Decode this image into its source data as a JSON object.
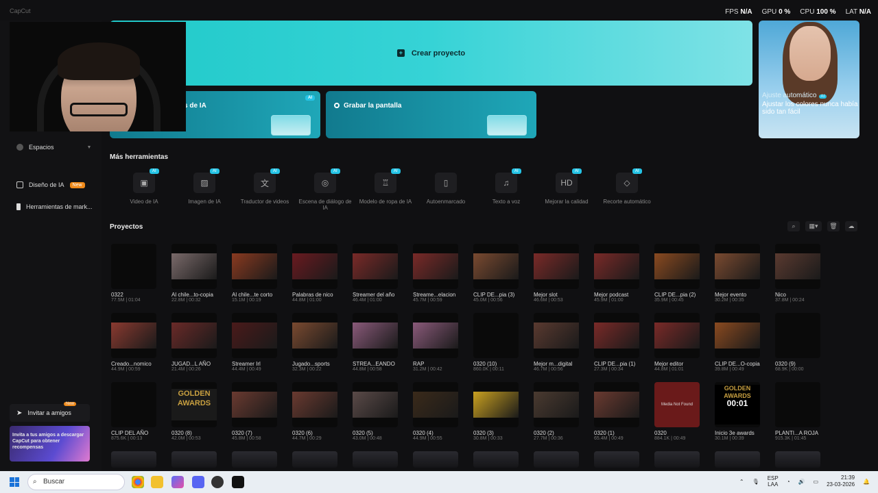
{
  "app": {
    "title": "CapCut"
  },
  "perf": [
    {
      "label": "FPS",
      "value": "N/A"
    },
    {
      "label": "GPU",
      "value": "0 %"
    },
    {
      "label": "CPU",
      "value": "100 %"
    },
    {
      "label": "LAT",
      "value": "N/A"
    }
  ],
  "sidebar": {
    "spaces": "Espacios",
    "ai_design": "Diseño de IA",
    "new_badge": "New",
    "marketing": "Herramientas de mark...",
    "invite": "Invitar a amigos",
    "invite_badge": "New",
    "promo": "Invita a tus amigos a descargar CapCut para obtener recompensas"
  },
  "hero": {
    "create": "Crear proyecto",
    "card1": "s de IA",
    "card2": "Grabar la pantalla",
    "ai": "AI"
  },
  "promo_right": {
    "t1": "Ajuste automático",
    "t2": "Ajustar los colores nunca había sido tan fácil"
  },
  "tools_title": "Más herramientas",
  "tools": [
    {
      "label": "Video de IA",
      "icon": "▣",
      "ai": true
    },
    {
      "label": "Imagen de IA",
      "icon": "▨",
      "ai": true
    },
    {
      "label": "Traductor de videos",
      "icon": "文",
      "ai": true
    },
    {
      "label": "Escena de diálogo de IA",
      "icon": "◎",
      "ai": true
    },
    {
      "label": "Modelo de ropa de IA",
      "icon": "♖",
      "ai": true
    },
    {
      "label": "Autoenmarcado",
      "icon": "▯",
      "ai": false
    },
    {
      "label": "Texto a voz",
      "icon": "♫",
      "ai": true
    },
    {
      "label": "Mejorar la calidad",
      "icon": "HD",
      "ai": true
    },
    {
      "label": "Recorte automático",
      "icon": "◇",
      "ai": true
    }
  ],
  "projects_title": "Proyectos",
  "projects": [
    {
      "name": "0322",
      "meta": "77.5M | 01:04",
      "c": ""
    },
    {
      "name": "Al chile...to-copia",
      "meta": "22.8M | 00:32",
      "c": "#7a6a6a"
    },
    {
      "name": "Al chile...te corto",
      "meta": "15.1M | 00:19",
      "c": "#8a3a20"
    },
    {
      "name": "Palabras de nico",
      "meta": "44.8M | 01:00",
      "c": "#6a1a20"
    },
    {
      "name": "Streamer del año",
      "meta": "46.4M | 01:00",
      "c": "#7a2a28"
    },
    {
      "name": "Streame...elacion",
      "meta": "45.7M | 00:59",
      "c": "#7a2a28"
    },
    {
      "name": "CLIP DE...pia (3)",
      "meta": "45.0M | 00:56",
      "c": "#7a4a30"
    },
    {
      "name": "Mejor slot",
      "meta": "46.6M | 00:53",
      "c": "#7a2a28"
    },
    {
      "name": "Mejor podcast",
      "meta": "45.9M | 01:00",
      "c": "#7a2a28"
    },
    {
      "name": "CLIP DE...pia (2)",
      "meta": "35.9M | 00:45",
      "c": "#8a4a20"
    },
    {
      "name": "Mejor evento",
      "meta": "30.2M | 00:35",
      "c": "#7a4a30"
    },
    {
      "name": "Nico",
      "meta": "37.8M | 00:24",
      "c": "#5a3a30"
    },
    {
      "name": "Creado...nomico",
      "meta": "44.9M | 00:59",
      "c": "#8a3a30"
    },
    {
      "name": "JUGAD...L AÑO",
      "meta": "21.4M | 00:26",
      "c": "#6a2a28"
    },
    {
      "name": "Streamer Irl",
      "meta": "44.4M | 00:49",
      "c": "#4a1a1a"
    },
    {
      "name": "Jugado...sports",
      "meta": "32.3M | 00:22",
      "c": "#7a4a30"
    },
    {
      "name": "STREA...EANDO",
      "meta": "44.8M | 00:58",
      "c": "#8a5a7a"
    },
    {
      "name": "RAP",
      "meta": "31.2M | 00:42",
      "c": "#8a5a7a"
    },
    {
      "name": "0320 (10)",
      "meta": "860.0K | 00:11",
      "c": ""
    },
    {
      "name": "Mejor m...digital",
      "meta": "46.7M | 00:56",
      "c": "#5a3a30"
    },
    {
      "name": "CLIP DE...pia (1)",
      "meta": "27.3M | 00:34",
      "c": "#7a2a28"
    },
    {
      "name": "Mejor editor",
      "meta": "44.8M | 01:01",
      "c": "#7a2a28"
    },
    {
      "name": "CLIP DE...O-copia",
      "meta": "39.8M | 00:49",
      "c": "#8a4a20"
    },
    {
      "name": "0320 (9)",
      "meta": "68.9K | 00:00",
      "c": ""
    },
    {
      "name": "CLIP DEL AÑO",
      "meta": "875.6K | 00:13",
      "c": ""
    },
    {
      "name": "0320 (8)",
      "meta": "42.0M | 00:53",
      "c": "#4a3a18"
    },
    {
      "name": "0320 (7)",
      "meta": "45.8M | 00:58",
      "c": "#6a3a30"
    },
    {
      "name": "0320 (6)",
      "meta": "44.7M | 00:29",
      "c": "#6a3a30"
    },
    {
      "name": "0320 (5)",
      "meta": "43.0M | 00:48",
      "c": "#5a4a48"
    },
    {
      "name": "0320 (4)",
      "meta": "44.9M | 00:55",
      "c": "#3a2a1a"
    },
    {
      "name": "0320 (3)",
      "meta": "30.8M | 00:33",
      "c": "#c9a020"
    },
    {
      "name": "0320 (2)",
      "meta": "27.7M | 00:36",
      "c": "#4a3a30"
    },
    {
      "name": "0320 (1)",
      "meta": "65.4M | 00:49",
      "c": "#6a3a30"
    },
    {
      "name": "0320",
      "meta": "884.1K | 00:49",
      "c": "#6a1a1a"
    },
    {
      "name": "Inicio 3e awards",
      "meta": "30.1M | 00:39",
      "c": "#000"
    },
    {
      "name": "PLANTI...A ROJA",
      "meta": "915.3K | 01:45",
      "c": ""
    }
  ],
  "taskbar": {
    "search": "Buscar",
    "lang1": "ESP",
    "lang2": "LAA",
    "time": "21:39",
    "date": "23-03-2026"
  },
  "thumb_text": {
    "golden": "GOLDEN",
    "awards": "AWARDS",
    "time": "00:01",
    "nf": "Media Not Found"
  }
}
